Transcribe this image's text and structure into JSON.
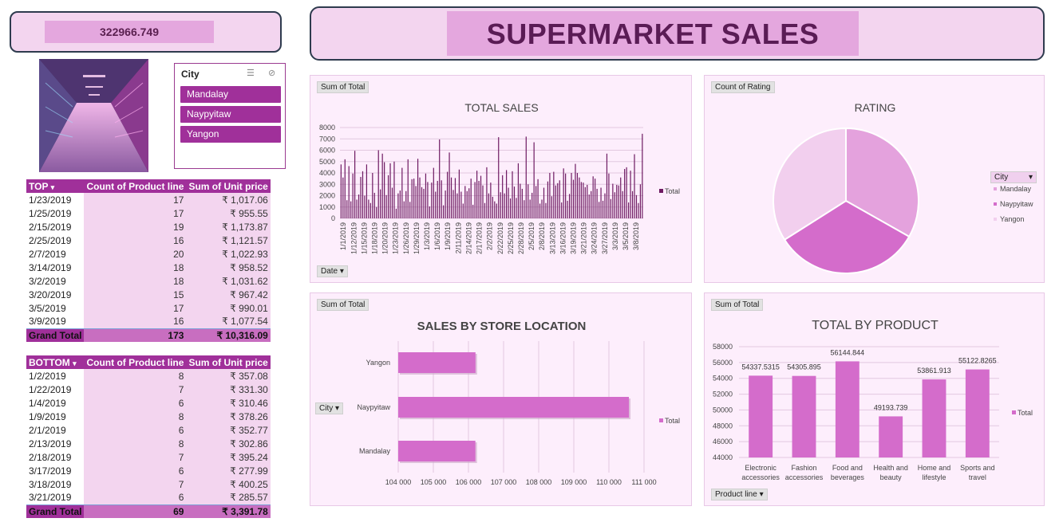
{
  "kpi": {
    "value": "322966.749"
  },
  "header": {
    "title": "SUPERMARKET SALES"
  },
  "slicer": {
    "title": "City",
    "items": [
      "Mandalay",
      "Naypyitaw",
      "Yangon"
    ]
  },
  "top_table": {
    "headers": [
      "TOP",
      "Count of Product line",
      "Sum of Unit price"
    ],
    "rows": [
      [
        "1/23/2019",
        "17",
        "₹ 1,017.06"
      ],
      [
        "1/25/2019",
        "17",
        "₹ 955.55"
      ],
      [
        "2/15/2019",
        "19",
        "₹ 1,173.87"
      ],
      [
        "2/25/2019",
        "16",
        "₹ 1,121.57"
      ],
      [
        "2/7/2019",
        "20",
        "₹ 1,022.93"
      ],
      [
        "3/14/2019",
        "18",
        "₹ 958.52"
      ],
      [
        "3/2/2019",
        "18",
        "₹ 1,031.62"
      ],
      [
        "3/20/2019",
        "15",
        "₹ 967.42"
      ],
      [
        "3/5/2019",
        "17",
        "₹ 990.01"
      ],
      [
        "3/9/2019",
        "16",
        "₹ 1,077.54"
      ]
    ],
    "grand_total": [
      "Grand Total",
      "173",
      "₹ 10,316.09"
    ]
  },
  "bottom_table": {
    "headers": [
      "BOTTOM",
      "Count of Product line",
      "Sum of Unit price"
    ],
    "rows": [
      [
        "1/2/2019",
        "8",
        "₹ 357.08"
      ],
      [
        "1/22/2019",
        "7",
        "₹ 331.30"
      ],
      [
        "1/4/2019",
        "6",
        "₹ 310.46"
      ],
      [
        "1/9/2019",
        "8",
        "₹ 378.26"
      ],
      [
        "2/1/2019",
        "6",
        "₹ 352.77"
      ],
      [
        "2/13/2019",
        "8",
        "₹ 302.86"
      ],
      [
        "2/18/2019",
        "7",
        "₹ 395.24"
      ],
      [
        "3/17/2019",
        "6",
        "₹ 277.99"
      ],
      [
        "3/18/2019",
        "7",
        "₹ 400.25"
      ],
      [
        "3/21/2019",
        "6",
        "₹ 285.57"
      ]
    ],
    "grand_total": [
      "Grand Total",
      "69",
      "₹ 3,391.78"
    ]
  },
  "chart_data": [
    {
      "type": "bar",
      "field_button": "Sum of Total",
      "axis_button": "Date",
      "title": "TOTAL SALES",
      "legend": "Total",
      "legend_position": "right",
      "ylim": [
        0,
        8000
      ],
      "yticks": [
        "0",
        "1000",
        "2000",
        "3000",
        "4000",
        "5000",
        "6000",
        "7000",
        "8000"
      ],
      "xtick_labels": [
        "1/1/2019",
        "1/12/2019",
        "1/15/2019",
        "1/18/2019",
        "1/20/2019",
        "1/23/2019",
        "1/26/2019",
        "1/29/2019",
        "1/3/2019",
        "1/6/2019",
        "1/9/2019",
        "2/11/2019",
        "2/14/2019",
        "2/17/2019",
        "2/2/2019",
        "2/22/2019",
        "2/25/2019",
        "2/28/2019",
        "2/5/2019",
        "2/8/2019",
        "3/13/2019",
        "3/16/2019",
        "3/19/2019",
        "3/21/2019",
        "3/24/2019",
        "3/27/2019",
        "3/3/2019",
        "3/5/2019",
        "3/8/2019"
      ],
      "values": [
        4750,
        3600,
        5200,
        1600,
        4600,
        1500,
        3950,
        5950,
        1650,
        2100,
        3650,
        4150,
        2000,
        4750,
        1650,
        1350,
        4000,
        2250,
        1000,
        6000,
        2550,
        5700,
        4950,
        2050,
        3800,
        4850,
        2700,
        5000,
        850,
        2200,
        2450,
        4450,
        1500,
        2400,
        5200,
        1450,
        3450,
        3500,
        2850,
        5250,
        3600,
        2750,
        2600,
        3950,
        3200,
        1050,
        3150,
        4450,
        2350,
        3300,
        6950,
        3350,
        1150,
        2450,
        4100,
        5800,
        3600,
        2500,
        3550,
        2200,
        4300,
        2350,
        1300,
        2850,
        2400,
        2650,
        3500,
        1200,
        3200,
        4200,
        3300,
        3750,
        2900,
        1350,
        4500,
        2200,
        3150,
        1900,
        1500,
        1300,
        7150,
        2300,
        3800,
        2200,
        4250,
        2700,
        1750,
        4150,
        2800,
        1800,
        4850,
        3050,
        2600,
        1600,
        7200,
        3000,
        1650,
        2250,
        6700,
        2850,
        3450,
        1300,
        1650,
        2700,
        1350,
        3250,
        4000,
        1950,
        4100,
        2900,
        3100,
        3350,
        1400,
        4400,
        3950,
        1550,
        2150,
        4000,
        3400,
        4800,
        4000,
        3600,
        3200,
        3150,
        2750,
        2950,
        2100,
        2400,
        3700,
        3500,
        2600,
        1450,
        2700,
        1550,
        2200,
        5700,
        3950,
        1700,
        3050,
        2300,
        2950,
        2900,
        3600,
        2400,
        4350,
        4500,
        1400,
        4200,
        2400,
        5650,
        2050,
        1350,
        3000,
        7450
      ]
    },
    {
      "type": "pie",
      "field_button": "Count of Rating",
      "title": "RATING",
      "legend_title": "City",
      "legend_position": "right",
      "categories": [
        "Mandalay",
        "Naypyitaw",
        "Yangon"
      ],
      "values": [
        332,
        328,
        340
      ],
      "colors": [
        "#e4a2dd",
        "#d46ccb",
        "#f2cfee"
      ]
    },
    {
      "type": "bar",
      "orientation": "horizontal",
      "field_button": "Sum of Total",
      "axis_button": "City",
      "title": "SALES BY STORE LOCATION",
      "legend": "Total",
      "legend_position": "right",
      "categories": [
        "Yangon",
        "Naypyitaw",
        "Mandalay"
      ],
      "values": [
        106200,
        110569,
        106197
      ],
      "xlim": [
        104000,
        111000
      ],
      "xticks": [
        "104 000",
        "105 000",
        "106 000",
        "107 000",
        "108 000",
        "109 000",
        "110 000",
        "111 000"
      ]
    },
    {
      "type": "bar",
      "field_button": "Sum of Total",
      "axis_button": "Product line",
      "title": "TOTAL BY PRODUCT",
      "legend": "Total",
      "legend_position": "right",
      "categories": [
        "Electronic accessories",
        "Fashion accessories",
        "Food and beverages",
        "Health and beauty",
        "Home and lifestyle",
        "Sports and travel"
      ],
      "category_lines": [
        [
          "Electronic",
          "accessories"
        ],
        [
          "Fashion",
          "accessories"
        ],
        [
          "Food and",
          "beverages"
        ],
        [
          "Health and",
          "beauty"
        ],
        [
          "Home and",
          "lifestyle"
        ],
        [
          "Sports and",
          "travel"
        ]
      ],
      "values": [
        54337.5315,
        54305.895,
        56144.844,
        49193.739,
        53861.913,
        55122.8265
      ],
      "data_labels": [
        "54337.5315",
        "54305.895",
        "56144.844",
        "49193.739",
        "53861.913",
        "55122.8265"
      ],
      "ylim": [
        44000,
        58000
      ],
      "yticks": [
        "44000",
        "46000",
        "48000",
        "50000",
        "52000",
        "54000",
        "56000",
        "58000"
      ]
    }
  ]
}
